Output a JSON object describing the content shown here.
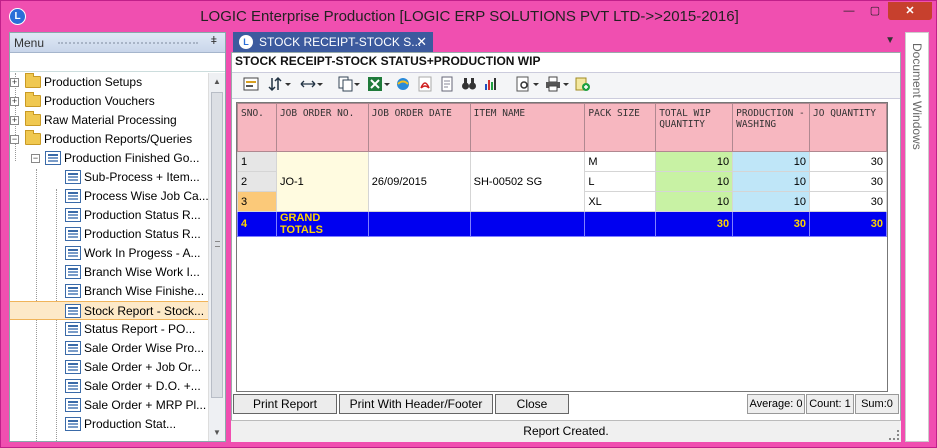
{
  "window": {
    "title": "LOGIC Enterprise Production  [LOGIC ERP SOLUTIONS PVT LTD->>2015-2016]",
    "app_icon_letter": "L",
    "minimize": "—",
    "maximize": "▢",
    "close": "✕"
  },
  "menu_pane": {
    "title": "Menu",
    "pin": "ǂ",
    "tree": [
      {
        "label": "Production Setups"
      },
      {
        "label": "Production Vouchers"
      },
      {
        "label": "Raw Material Processing"
      },
      {
        "label": "Production Reports/Queries"
      },
      {
        "label": "Production Finished Go..."
      },
      {
        "label": "Sub-Process + Item..."
      },
      {
        "label": "Process Wise Job Ca..."
      },
      {
        "label": "Production Status R..."
      },
      {
        "label": "Production Status R..."
      },
      {
        "label": "Work In Progess - A..."
      },
      {
        "label": "Branch Wise Work I..."
      },
      {
        "label": "Branch Wise Finishe..."
      },
      {
        "label": "Stock Report - Stock..."
      },
      {
        "label": "Status Report - PO..."
      },
      {
        "label": "Sale Order Wise Pro..."
      },
      {
        "label": "Sale Order + Job Or..."
      },
      {
        "label": "Sale Order + D.O. +..."
      },
      {
        "label": "Sale Order + MRP Pl..."
      },
      {
        "label": "Production Stat..."
      }
    ]
  },
  "tab": {
    "icon_letter": "L",
    "label": "STOCK RECEIPT-STOCK S...",
    "close": "✕",
    "dropdown": "▼"
  },
  "report": {
    "title": "STOCK RECEIPT-STOCK STATUS+PRODUCTION WIP"
  },
  "grid": {
    "columns": [
      "SNO.",
      "JOB ORDER NO.",
      "JOB ORDER DATE",
      "ITEM NAME",
      "PACK SIZE",
      "TOTAL WIP QUANTITY",
      "PRODUCTION -WASHING",
      "JO QUANTITY"
    ],
    "rows": [
      {
        "sno": "1",
        "job_order_no": "",
        "job_order_date": "",
        "item_name": "",
        "pack_size": "M",
        "total_wip": "10",
        "washing": "10",
        "jo_qty": "30"
      },
      {
        "sno": "2",
        "job_order_no": "JO-1",
        "job_order_date": "26/09/2015",
        "item_name": "SH-00502 SG",
        "pack_size": "L",
        "total_wip": "10",
        "washing": "10",
        "jo_qty": "30"
      },
      {
        "sno": "3",
        "job_order_no": "",
        "job_order_date": "",
        "item_name": "",
        "pack_size": "XL",
        "total_wip": "10",
        "washing": "10",
        "jo_qty": "30"
      }
    ],
    "total": {
      "sno": "4",
      "label": "GRAND TOTALS",
      "total_wip": "30",
      "washing": "30",
      "jo_qty": "30"
    }
  },
  "buttons": {
    "print_report": "Print Report",
    "print_header_footer": "Print With Header/Footer",
    "close": "Close"
  },
  "stats": {
    "average": "Average: 0",
    "count": "Count: 1",
    "sum": "Sum:0"
  },
  "status": "Report Created.",
  "right_pane": {
    "label": "Document Windows"
  }
}
